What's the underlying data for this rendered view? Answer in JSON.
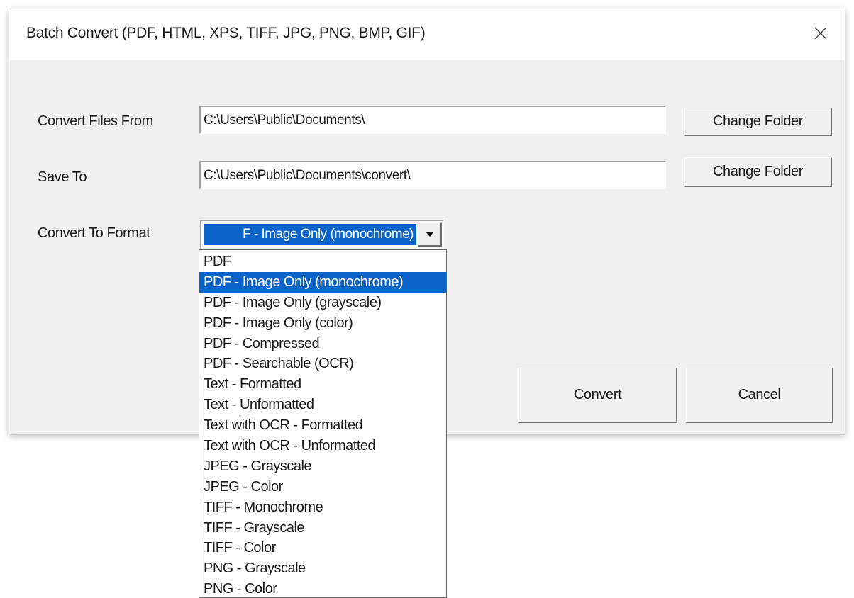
{
  "window": {
    "title": "Batch Convert (PDF, HTML, XPS, TIFF, JPG, PNG, BMP, GIF)",
    "close_icon": "close-icon"
  },
  "form": {
    "convert_from_label": "Convert Files From",
    "convert_from_value": "C:\\Users\\Public\\Documents\\",
    "save_to_label": "Save To",
    "save_to_value": "C:\\Users\\Public\\Documents\\convert\\",
    "format_label": "Convert To Format",
    "format_selected_visible": "F - Image Only (monochrome)",
    "change_folder_label": "Change Folder",
    "change_folder_label_2": "Change Folder"
  },
  "actions": {
    "convert_label": "Convert",
    "cancel_label": "Cancel"
  },
  "format_options": [
    "PDF",
    "PDF - Image Only (monochrome)",
    "PDF - Image Only (grayscale)",
    "PDF - Image Only (color)",
    "PDF - Compressed",
    "PDF - Searchable (OCR)",
    "Text - Formatted",
    "Text - Unformatted",
    "Text with OCR - Formatted",
    "Text with OCR - Unformatted",
    "JPEG - Grayscale",
    "JPEG - Color",
    "TIFF - Monochrome",
    "TIFF - Grayscale",
    "TIFF - Color",
    "PNG - Grayscale",
    "PNG - Color"
  ],
  "selected_index": 1,
  "colors": {
    "selection": "#0a63c9",
    "dialog_bg": "#f0f0f0"
  }
}
